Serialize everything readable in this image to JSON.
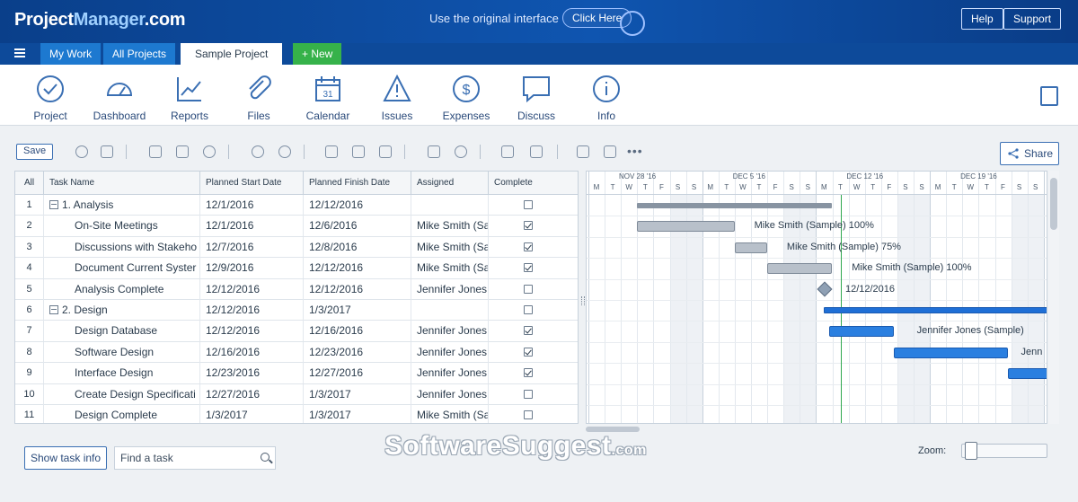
{
  "header": {
    "logo_part1": "Project",
    "logo_part2": "Manager",
    "logo_part3": ".com",
    "banner_text": "Use the original interface",
    "banner_button": "Click Here",
    "help": "Help",
    "support": "Support"
  },
  "tabs": [
    {
      "label": "My Work"
    },
    {
      "label": "All Projects"
    },
    {
      "label": "Sample Project"
    },
    {
      "label": "+ New"
    }
  ],
  "nav": [
    {
      "label": "Project",
      "icon": "check-circle-icon"
    },
    {
      "label": "Dashboard",
      "icon": "gauge-icon"
    },
    {
      "label": "Reports",
      "icon": "line-chart-icon"
    },
    {
      "label": "Files",
      "icon": "paperclip-icon"
    },
    {
      "label": "Calendar",
      "icon": "calendar-icon"
    },
    {
      "label": "Issues",
      "icon": "warning-icon"
    },
    {
      "label": "Expenses",
      "icon": "dollar-icon"
    },
    {
      "label": "Discuss",
      "icon": "chat-icon"
    },
    {
      "label": "Info",
      "icon": "info-icon"
    }
  ],
  "toolbar": {
    "save": "Save",
    "more": "•••",
    "share": "Share"
  },
  "grid": {
    "columns": [
      "All",
      "Task Name",
      "Planned Start Date",
      "Planned Finish Date",
      "Assigned",
      "Complete"
    ],
    "rows": [
      {
        "num": "1",
        "name": "1. Analysis",
        "start": "12/1/2016",
        "finish": "12/12/2016",
        "assigned": "",
        "done": false,
        "summary": true
      },
      {
        "num": "2",
        "name": "On-Site Meetings",
        "start": "12/1/2016",
        "finish": "12/6/2016",
        "assigned": "Mike Smith (Sa",
        "done": true,
        "summary": false
      },
      {
        "num": "3",
        "name": "Discussions with Stakeho",
        "start": "12/7/2016",
        "finish": "12/8/2016",
        "assigned": "Mike Smith (Sa",
        "done": true,
        "summary": false
      },
      {
        "num": "4",
        "name": "Document Current Syster",
        "start": "12/9/2016",
        "finish": "12/12/2016",
        "assigned": "Mike Smith (Sa",
        "done": true,
        "summary": false
      },
      {
        "num": "5",
        "name": "Analysis Complete",
        "start": "12/12/2016",
        "finish": "12/12/2016",
        "assigned": "Jennifer Jones",
        "done": false,
        "summary": false
      },
      {
        "num": "6",
        "name": "2. Design",
        "start": "12/12/2016",
        "finish": "1/3/2017",
        "assigned": "",
        "done": false,
        "summary": true
      },
      {
        "num": "7",
        "name": "Design Database",
        "start": "12/12/2016",
        "finish": "12/16/2016",
        "assigned": "Jennifer Jones",
        "done": true,
        "summary": false
      },
      {
        "num": "8",
        "name": "Software Design",
        "start": "12/16/2016",
        "finish": "12/23/2016",
        "assigned": "Jennifer Jones",
        "done": true,
        "summary": false
      },
      {
        "num": "9",
        "name": "Interface Design",
        "start": "12/23/2016",
        "finish": "12/27/2016",
        "assigned": "Jennifer Jones",
        "done": true,
        "summary": false
      },
      {
        "num": "10",
        "name": "Create Design Specificati",
        "start": "12/27/2016",
        "finish": "1/3/2017",
        "assigned": "Jennifer Jones",
        "done": false,
        "summary": false
      },
      {
        "num": "11",
        "name": "Design Complete",
        "start": "1/3/2017",
        "finish": "1/3/2017",
        "assigned": "Mike Smith (Sa",
        "done": false,
        "summary": false
      }
    ]
  },
  "gantt": {
    "weeks": [
      "NOV 28 '16",
      "DEC 5 '16",
      "DEC 12 '16",
      "DEC 19 '16"
    ],
    "day_letters": [
      "M",
      "T",
      "W",
      "T",
      "F",
      "S",
      "S"
    ],
    "labels": {
      "row2": "Mike Smith (Sample)  100%",
      "row3": "Mike Smith (Sample)  75%",
      "row4": "Mike Smith (Sample)  100%",
      "row5": "12/12/2016",
      "row7": "Jennifer Jones (Sample)",
      "row8": "Jenn"
    }
  },
  "footer": {
    "show_task_info": "Show task info",
    "find_placeholder": "Find a task",
    "zoom": "Zoom:",
    "watermark_main": "SoftwareSuggest",
    "watermark_suffix": ".com"
  }
}
